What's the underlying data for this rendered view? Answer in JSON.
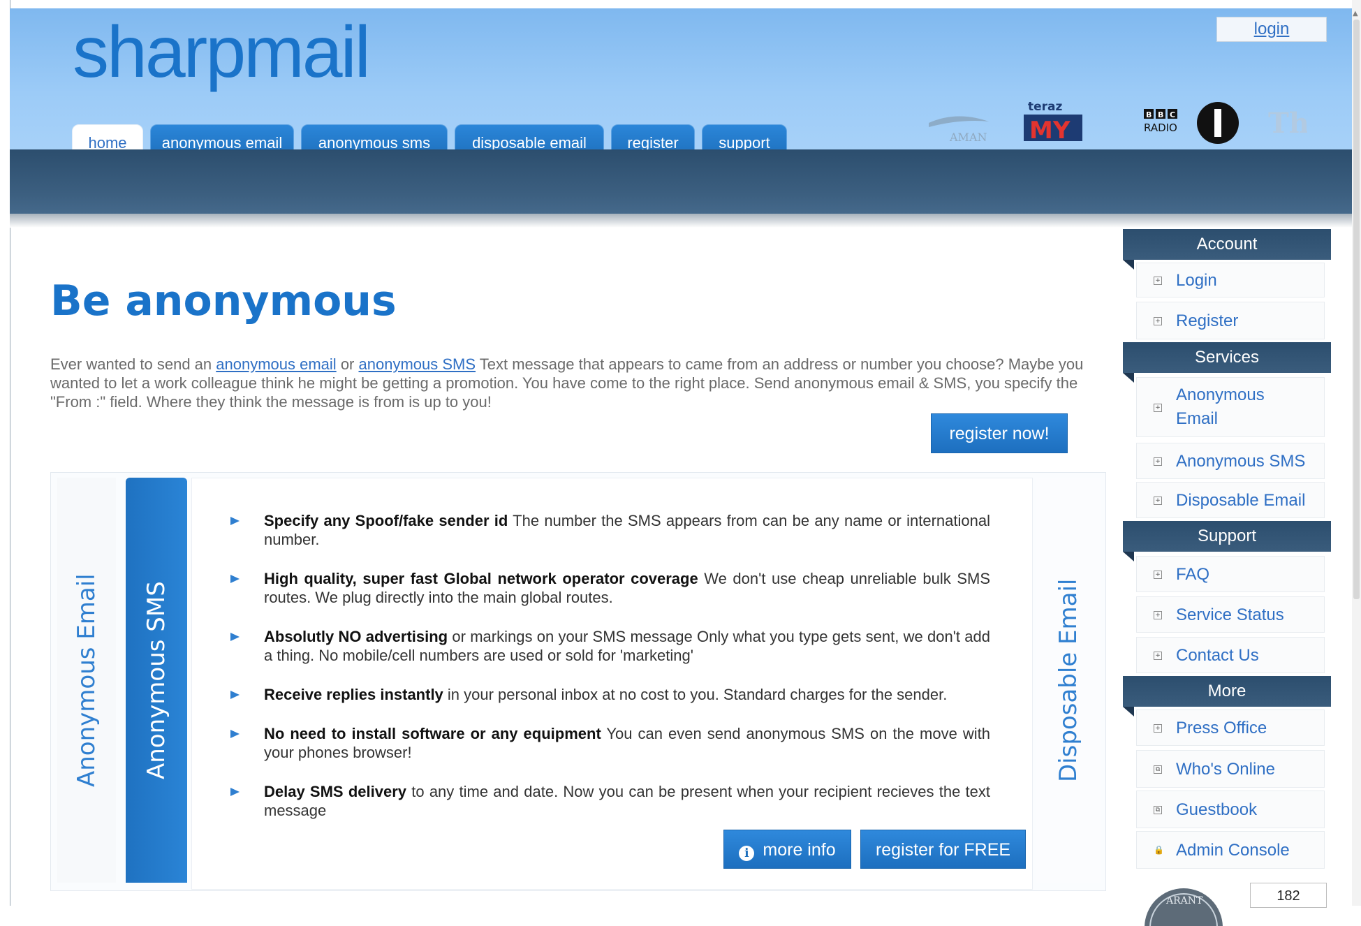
{
  "header": {
    "logo_text": "sharpmail",
    "login_label": "login",
    "tabs": [
      {
        "label": "home"
      },
      {
        "label": "anonymous email"
      },
      {
        "label": "anonymous sms"
      },
      {
        "label": "disposable email"
      },
      {
        "label": "register"
      },
      {
        "label": "support"
      }
    ],
    "media_logos": [
      "AMAN",
      "teraz MY",
      "BBC RADIO 1"
    ]
  },
  "main": {
    "headline": "Be anonymous",
    "intro_part1": "Ever wanted to send an ",
    "intro_link1": "anonymous email",
    "intro_part2": " or ",
    "intro_link2": "anonymous SMS",
    "intro_part3": " Text message that appears to came from an address or number you choose? Maybe you wanted to let a work colleague think he might be getting a promotion. You have come to the right place. Send anonymous email & SMS, you specify the \"From :\" field. Where they think the message is from is up to you!",
    "register_now_label": "register now!",
    "vertical_tabs": {
      "anonymous_email": "Anonymous Email",
      "anonymous_sms": "Anonymous SMS",
      "disposable_email": "Disposable Email"
    },
    "features": [
      {
        "bold": "Specify any Spoof/fake sender id",
        "text": " The number the SMS appears from can be any name or international number."
      },
      {
        "bold": "High quality, super fast Global network operator coverage",
        "text": " We don't use cheap unreliable bulk SMS routes. We plug directly into the main global routes."
      },
      {
        "bold": "Absolutly NO advertising",
        "text": " or markings on your SMS message Only what you type gets sent, we don't add a thing. No mobile/cell numbers are used or sold for 'marketing'"
      },
      {
        "bold": "Receive replies instantly",
        "text": " in your personal inbox at no cost to you. Standard charges for the sender."
      },
      {
        "bold": "No need to install software or any equipment",
        "text": " You can even send anonymous SMS on the move with your phones browser!"
      },
      {
        "bold": "Delay SMS delivery",
        "text": " to any time and date. Now you can be present when your recipient recieves the text message"
      }
    ],
    "more_info_label": "more info",
    "register_free_label": "register for FREE"
  },
  "sidebar": {
    "account": {
      "title": "Account",
      "items": [
        {
          "label": "Login"
        },
        {
          "label": "Register"
        }
      ]
    },
    "services": {
      "title": "Services",
      "items": [
        {
          "label": "Anonymous Email"
        },
        {
          "label": "Anonymous SMS"
        },
        {
          "label": "Disposable Email"
        }
      ]
    },
    "support": {
      "title": "Support",
      "items": [
        {
          "label": "FAQ"
        },
        {
          "label": "Service Status"
        },
        {
          "label": "Contact Us"
        }
      ]
    },
    "more": {
      "title": "More",
      "items": [
        {
          "label": "Press Office"
        },
        {
          "label": "Who's Online"
        },
        {
          "label": "Guestbook"
        },
        {
          "label": "Admin Console"
        }
      ]
    },
    "badge_text": "GUARANTEE",
    "counter": "182"
  },
  "colors": {
    "brand_blue": "#1a73c9",
    "nav_dark": "#2c4e6e",
    "link": "#2f6fc4"
  }
}
